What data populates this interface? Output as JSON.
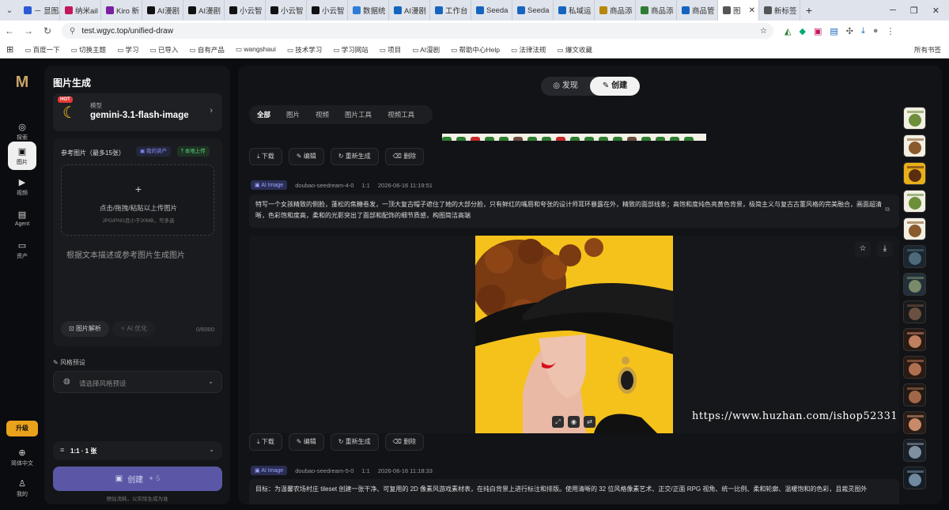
{
  "browser": {
    "tabs": [
      {
        "label": "－ 显图A",
        "color": "#2b5bd7"
      },
      {
        "label": "纳米aiI",
        "color": "#c2185b"
      },
      {
        "label": "Kiro 新",
        "color": "#7b1fa2"
      },
      {
        "label": "AI漫剧",
        "color": "#111111"
      },
      {
        "label": "AI漫剧",
        "color": "#111111"
      },
      {
        "label": "小云智",
        "color": "#111111"
      },
      {
        "label": "小云智",
        "color": "#111111"
      },
      {
        "label": "小云智",
        "color": "#111111"
      },
      {
        "label": "数据统",
        "color": "#2e7dd7"
      },
      {
        "label": "AI漫剧",
        "color": "#1565c0"
      },
      {
        "label": "工作台",
        "color": "#1565c0"
      },
      {
        "label": "Seeda",
        "color": "#1565c0"
      },
      {
        "label": "Seeda",
        "color": "#1565c0"
      },
      {
        "label": "私域运",
        "color": "#1565c0"
      },
      {
        "label": "商品添",
        "color": "#b8860b"
      },
      {
        "label": "商品添",
        "color": "#2e7d32"
      },
      {
        "label": "商品管",
        "color": "#1565c0"
      },
      {
        "label": "图",
        "color": "#555555",
        "active": true
      },
      {
        "label": "新标签",
        "color": "#555555"
      }
    ],
    "new_tab": "+",
    "url": "test.wgyc.top/unified-draw",
    "bookmarks": [
      "百度一下",
      "切换主题",
      "学习",
      "已导入",
      "自有产品",
      "wangshaui",
      "技术学习",
      "学习网站",
      "项目",
      "AI漫剧",
      "帮助中心Help",
      "法律法规",
      "爆文收藏"
    ],
    "bookmarks_right": "所有书签"
  },
  "rail": {
    "items": [
      {
        "label": "探索",
        "icon": "compass-icon",
        "glyph": "◎"
      },
      {
        "label": "图片",
        "icon": "image-icon",
        "glyph": "▣",
        "active": true
      },
      {
        "label": "视频",
        "icon": "video-icon",
        "glyph": "▶"
      },
      {
        "label": "Agent",
        "icon": "agent-icon",
        "glyph": "▤"
      },
      {
        "label": "资产",
        "icon": "folder-icon",
        "glyph": "▭"
      }
    ],
    "upgrade": "升级",
    "language": "简体中文",
    "profile": "我的"
  },
  "panel": {
    "title": "图片生成",
    "model": {
      "hot": "HOT",
      "label": "模型",
      "name": "gemini-3.1-flash-image"
    },
    "reference": {
      "title": "参考图片（最多15张）",
      "my_assets": "我的资产",
      "local_upload": "本地上传",
      "upload_text": "点击/拖拽/粘贴以上传图片",
      "upload_hint": "JPG/PNG且小于20MB，可多选"
    },
    "prompt_placeholder": "根据文本描述或参考图片生成图片",
    "parse_button": "图片解析",
    "optimize_button": "AI 优化",
    "char_count": "0/6000",
    "style_label": "风格预设",
    "style_placeholder": "请选择风格预设",
    "ratio": "1:1 · 1 张",
    "create": "创建",
    "create_cost": "5",
    "hint": "预估消耗，以实际生成为准"
  },
  "main": {
    "segments": [
      "发现",
      "创建"
    ],
    "active_segment": "创建",
    "filters": [
      "全部",
      "图片",
      "视频",
      "图片工具",
      "视频工具"
    ],
    "active_filter": "全部",
    "actions": [
      "下载",
      "编辑",
      "重新生成",
      "删除"
    ],
    "records": [
      {
        "tag": "AI Image",
        "model": "doubao-seedream-4-0",
        "ratio": "1:1",
        "time": "2026-06-16 11:19:51",
        "prompt": "特写一个女孩精致的侧脸，蓬松的焦糖卷发，一顶大复古帽子遮住了她的大部分脸，只有鲜红的嘴唇和夸张的设计师耳环暴露在外，精致的面部线条；高饱和度纯色亮黄色背景，极简主义与复古古董风格的完美融合，画面超清晰，色彩饱和度高，柔和的光影突出了面部和配饰的细节质感，构图简洁高端"
      },
      {
        "tag": "AI Image",
        "model": "doubao-seedream-5-0",
        "ratio": "1:1",
        "time": "2026-06-16 11:18:33",
        "prompt": "目标：为温馨农场村庄 tileset 创建一张干净、可复用的 2D 像素风游戏素材表，在纯白背景上进行标注和排版。使用清晰的 32 位风格像素艺术、正交/正面 RPG 视角、统一比例、柔和轮廓、温暖饱和的色彩，且裁灵图外"
      }
    ],
    "watermark": "https://www.huzhan.com/ishop52331"
  },
  "colors": {
    "accent": "#5a58a6",
    "upgrade": "#e9a21b",
    "portrait_bg": "#f5c21b",
    "lips": "#d3121c"
  }
}
